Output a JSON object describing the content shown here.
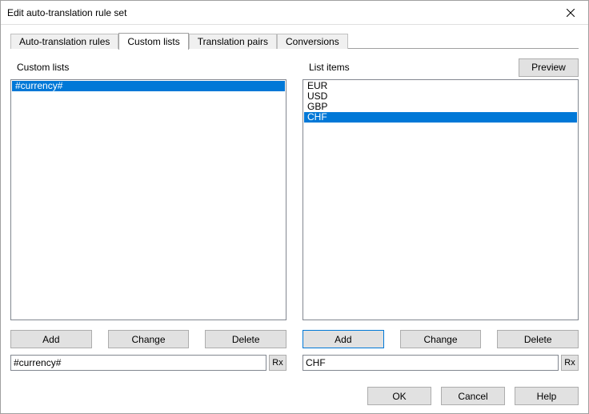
{
  "window": {
    "title": "Edit auto-translation rule set"
  },
  "tabs": {
    "auto_translation": "Auto-translation rules",
    "custom_lists": "Custom lists",
    "translation_pairs": "Translation pairs",
    "conversions": "Conversions"
  },
  "left": {
    "label": "Custom lists",
    "items": [
      "#currency#"
    ],
    "selected_index": 0,
    "buttons": {
      "add": "Add",
      "change": "Change",
      "delete": "Delete"
    },
    "input_value": "#currency#",
    "rx_label": "Rx"
  },
  "right": {
    "label": "List items",
    "preview": "Preview",
    "items": [
      "EUR",
      "USD",
      "GBP",
      "CHF"
    ],
    "selected_index": 3,
    "buttons": {
      "add": "Add",
      "change": "Change",
      "delete": "Delete"
    },
    "input_value": "CHF",
    "rx_label": "Rx"
  },
  "dialog": {
    "ok": "OK",
    "cancel": "Cancel",
    "help": "Help"
  }
}
